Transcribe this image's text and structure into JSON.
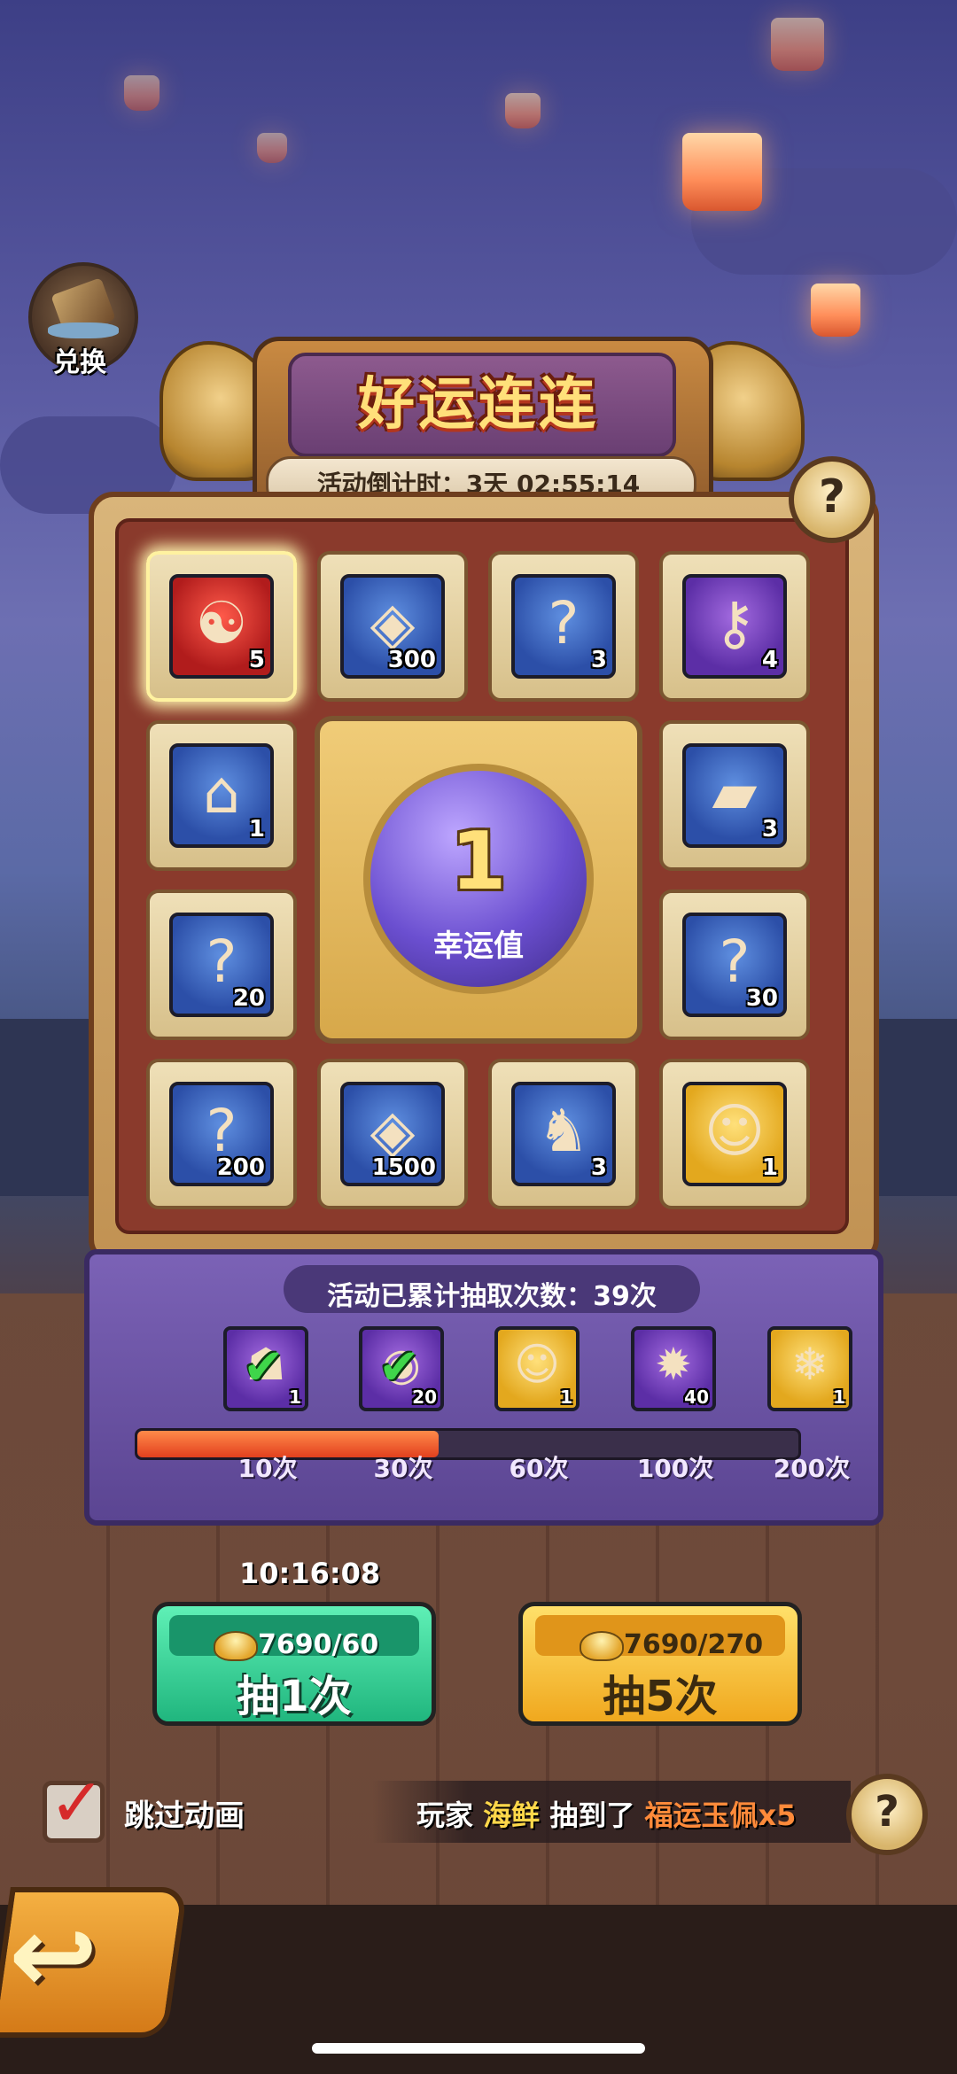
{
  "exchange": {
    "label": "兑换"
  },
  "header": {
    "title": "好运连连",
    "countdown": "活动倒计时：3天 02:55:14"
  },
  "help_glyph": "?",
  "grid": [
    {
      "pos": 0,
      "color": "red",
      "icon": "jade-pendant-icon",
      "glyph": "☯",
      "count": "5",
      "highlight": true
    },
    {
      "pos": 1,
      "color": "blue",
      "icon": "copper-coin-icon",
      "glyph": "◈",
      "count": "300"
    },
    {
      "pos": 2,
      "color": "blue",
      "icon": "mystery-scroll-icon",
      "glyph": "?",
      "count": "3"
    },
    {
      "pos": 3,
      "color": "purple",
      "icon": "golden-key-icon",
      "glyph": "⚷",
      "count": "4"
    },
    {
      "pos": 4,
      "color": "blue",
      "icon": "map-scroll-icon",
      "glyph": "⌂",
      "count": "1"
    },
    {
      "pos": 5,
      "color": "blue",
      "icon": "stone-block-icon",
      "glyph": "▰",
      "count": "3"
    },
    {
      "pos": 6,
      "color": "blue",
      "icon": "mystery-scroll-icon",
      "glyph": "?",
      "count": "20"
    },
    {
      "pos": 7,
      "color": "blue",
      "icon": "red-mystery-scroll-icon",
      "glyph": "?",
      "count": "30"
    },
    {
      "pos": 8,
      "color": "blue",
      "icon": "red-mystery-scroll-icon",
      "glyph": "?",
      "count": "200"
    },
    {
      "pos": 9,
      "color": "blue",
      "icon": "copper-coin-icon",
      "glyph": "◈",
      "count": "1500"
    },
    {
      "pos": 10,
      "color": "blue",
      "icon": "stone-beast-icon",
      "glyph": "♞",
      "count": "3"
    },
    {
      "pos": 11,
      "color": "gold",
      "icon": "hero-portrait-icon",
      "glyph": "☺",
      "count": "1"
    }
  ],
  "luck": {
    "value": "1",
    "label": "幸运值"
  },
  "progress": {
    "title": "活动已累计抽取次数：39次",
    "current": 39,
    "fill_fraction": 0.46,
    "rewards": [
      {
        "icon": "warrior-portrait-icon",
        "color": "purple",
        "glyph": "☗",
        "count": "1",
        "claimed": true
      },
      {
        "icon": "dragon-orb-icon",
        "color": "purple",
        "glyph": "◉",
        "count": "20",
        "claimed": true
      },
      {
        "icon": "hero-portrait-icon",
        "color": "gold",
        "glyph": "☺",
        "count": "1",
        "claimed": false
      },
      {
        "icon": "fire-dragon-orb-icon",
        "color": "purple",
        "glyph": "✹",
        "count": "40",
        "claimed": false
      },
      {
        "icon": "ice-beast-icon",
        "color": "gold",
        "glyph": "❄",
        "count": "1",
        "claimed": false
      }
    ],
    "milestones": [
      "10次",
      "30次",
      "60次",
      "100次",
      "200次"
    ]
  },
  "timer": "10:16:08",
  "draw_one": {
    "cost": "7690/60",
    "label": "抽1次"
  },
  "draw_five": {
    "cost": "7690/270",
    "label": "抽5次"
  },
  "skip": {
    "label": "跳过动画",
    "checked": true,
    "check_glyph": "✓"
  },
  "broadcast": {
    "prefix": "玩家",
    "player": "海鲜",
    "middle": "抽到了",
    "item": "福运玉佩x5"
  },
  "back_glyph": "↩",
  "colors": {
    "accent_gold": "#ffe07a",
    "draw_one": "#20b67e",
    "draw_five": "#f0a81e",
    "progress_fill": "#e2401e"
  }
}
